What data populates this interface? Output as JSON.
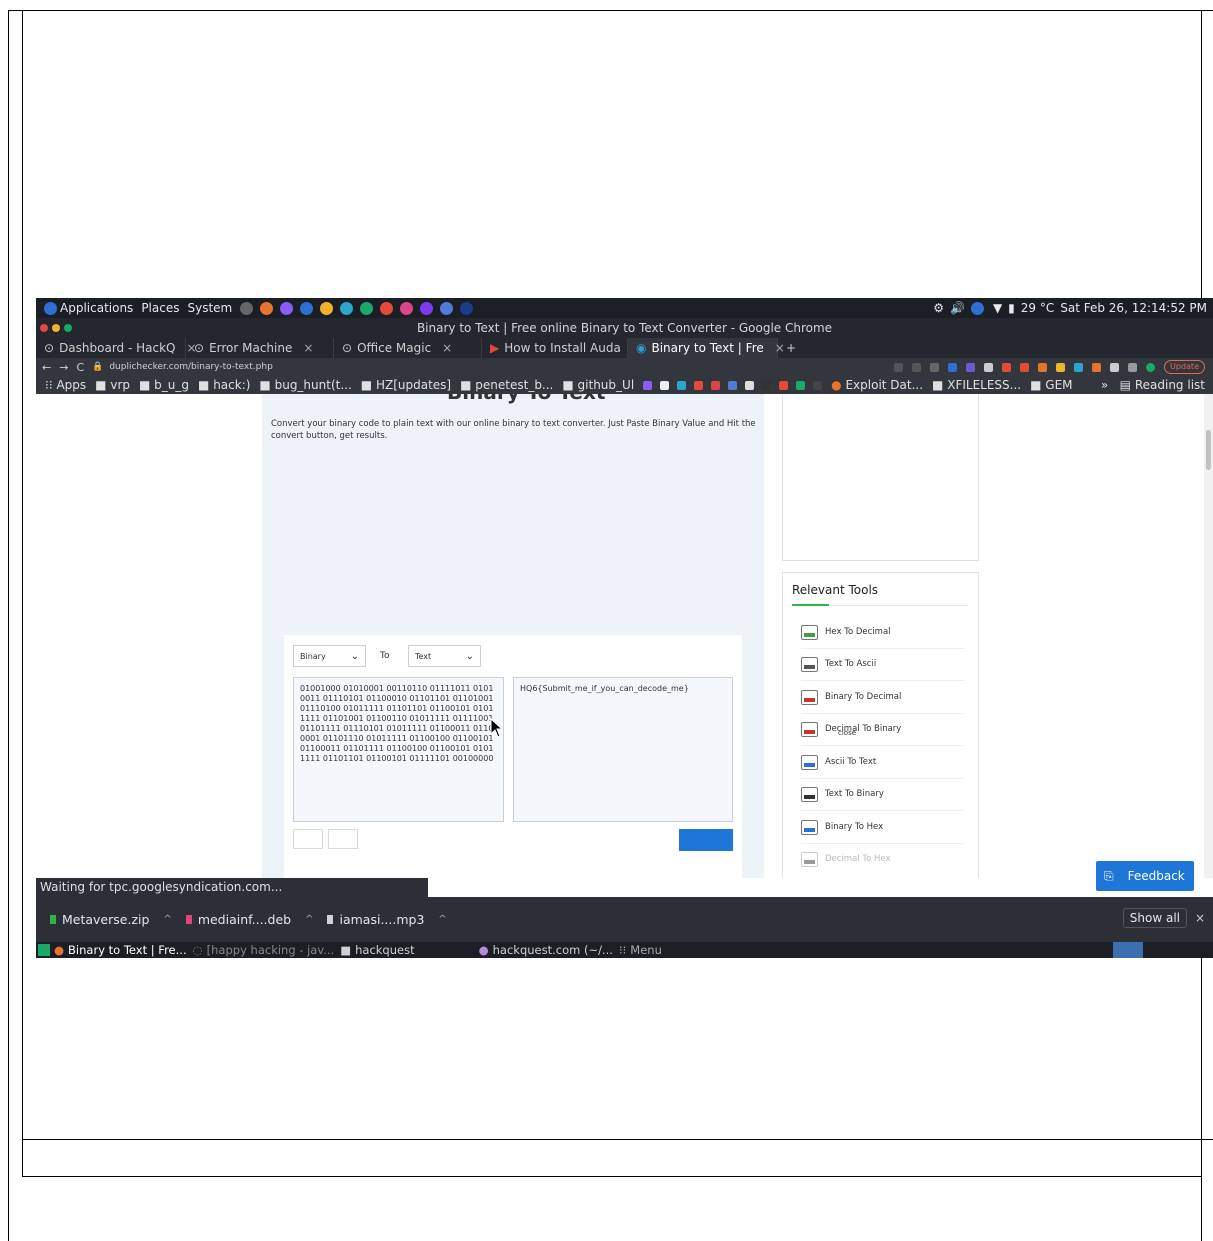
{
  "panel": {
    "applications": "Applications",
    "places": "Places",
    "system": "System",
    "weather": "29 °C",
    "clock": "Sat Feb 26, 12:14:52 PM"
  },
  "window": {
    "title": "Binary to Text | Free online Binary to Text Converter - Google Chrome"
  },
  "tabs": [
    {
      "label": "Dashboard - HackQ"
    },
    {
      "label": "Error Machine"
    },
    {
      "label": "Office Magic"
    },
    {
      "label": "How to Install Auda"
    },
    {
      "label": "Binary to Text | Fre"
    }
  ],
  "omnibox": {
    "url": "duplichecker.com/binary-to-text.php",
    "update_label": "Update"
  },
  "bookmarks": {
    "apps": "Apps",
    "items": [
      "vrp",
      "b_u_g",
      "hack:)",
      "bug_hunt(t...",
      "HZ[updates]",
      "penetest_b...",
      "github_Ul",
      "Exploit Dat...",
      "XFILELESS...",
      "GEM"
    ],
    "more": "»",
    "reading_list": "Reading list"
  },
  "page": {
    "heading": "Binary To Text",
    "intro": "Convert your binary code to plain text with our online binary to text converter. Just Paste Binary Value and Hit the convert button, get results.",
    "from_select": "Binary",
    "to_label": "To",
    "to_select": "Text",
    "binary_input": "01001000 01010001 00110110 01111011 01010011 01110101 01100010 01101101 01101001 01110100 01011111 01101101 01100101 01011111 01101001 01100110 01011111 01111001 01101111 01110101 01011111 01100011 01100001 01101110 01011111 01100100 01100101 01100011 01101111 01100100 01100101 01011111 01101101 01100101 01111101 00100000",
    "text_output": "HQ6{Submit_me_if_you_can_decode_me}"
  },
  "relevant_tools": {
    "title": "Relevant Tools",
    "items": [
      {
        "label": "Hex To Decimal",
        "color": "#3aa14a"
      },
      {
        "label": "Text To Ascii",
        "color": "#555555"
      },
      {
        "label": "Binary To Decimal",
        "color": "#c0392b"
      },
      {
        "label": "Decimal To Binary",
        "color": "#c0392b"
      },
      {
        "label": "Ascii To Text",
        "color": "#2e6fd6"
      },
      {
        "label": "Text To Binary",
        "color": "#333333"
      },
      {
        "label": "Binary To Hex",
        "color": "#2e6fd6"
      },
      {
        "label": "Decimal To Hex",
        "color": "#999999"
      }
    ],
    "close_label": "close"
  },
  "feedback_label": "Feedback",
  "status_text": "Waiting for tpc.googlesyndication.com...",
  "downloads": {
    "items": [
      {
        "name": "Metaverse.zip",
        "color": "#2fb34a"
      },
      {
        "name": "mediainf....deb",
        "color": "#e0457b"
      },
      {
        "name": "iamasi....mp3",
        "color": "#cfd3d8"
      }
    ],
    "show_all": "Show all"
  },
  "taskbar": {
    "items": [
      "Binary to Text | Fre...",
      "[happy hacking - jav...",
      "hackquest",
      "hackquest.com (~/...",
      "Menu"
    ]
  }
}
